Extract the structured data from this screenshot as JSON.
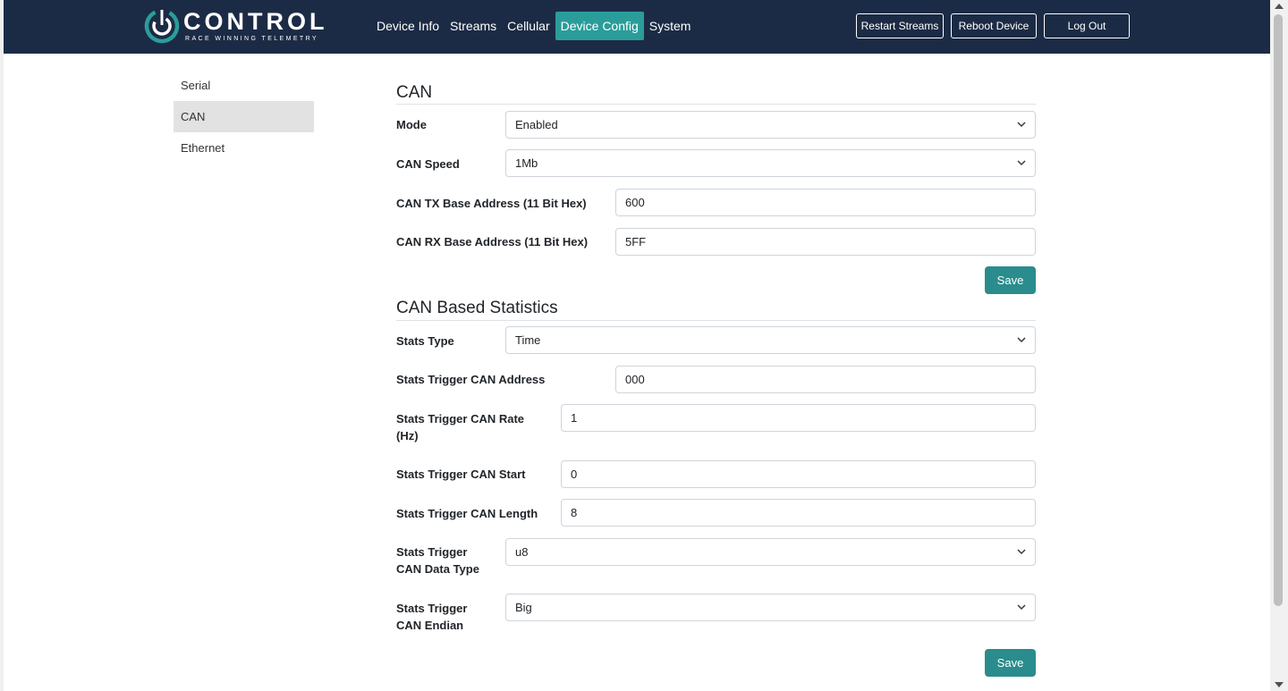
{
  "brand": {
    "name": "CONTROL",
    "tagline": "RACE WINNING TELEMETRY",
    "accent": "#2a9d9a",
    "navbar_bg": "#1c2b45"
  },
  "nav": {
    "items": [
      {
        "label": "Device Info",
        "active": false
      },
      {
        "label": "Streams",
        "active": false
      },
      {
        "label": "Cellular",
        "active": false
      },
      {
        "label": "Device Config",
        "active": true
      },
      {
        "label": "System",
        "active": false
      }
    ],
    "restart_streams": "Restart Streams",
    "reboot_device": "Reboot Device",
    "log_out": "Log Out"
  },
  "sidebar": {
    "items": [
      {
        "label": "Serial",
        "active": false
      },
      {
        "label": "CAN",
        "active": true
      },
      {
        "label": "Ethernet",
        "active": false
      }
    ]
  },
  "can": {
    "title": "CAN",
    "mode_label": "Mode",
    "mode_value": "Enabled",
    "speed_label": "CAN Speed",
    "speed_value": "1Mb",
    "tx_label": "CAN TX Base Address (11 Bit Hex)",
    "tx_value": "600",
    "rx_label": "CAN RX Base Address (11 Bit Hex)",
    "rx_value": "5FF",
    "save_label": "Save"
  },
  "stats": {
    "title": "CAN Based Statistics",
    "type_label": "Stats Type",
    "type_value": "Time",
    "addr_label": "Stats Trigger CAN Address",
    "addr_value": "000",
    "rate_label_1": "Stats Trigger CAN Rate",
    "rate_label_2": "(Hz)",
    "rate_value": "1",
    "start_label": "Stats Trigger CAN Start",
    "start_value": "0",
    "length_label": "Stats Trigger CAN Length",
    "length_value": "8",
    "dtype_label_1": "Stats Trigger",
    "dtype_label_2": "CAN Data Type",
    "dtype_value": "u8",
    "endian_label_1": "Stats Trigger",
    "endian_label_2": "CAN Endian",
    "endian_value": "Big",
    "save_label": "Save"
  }
}
